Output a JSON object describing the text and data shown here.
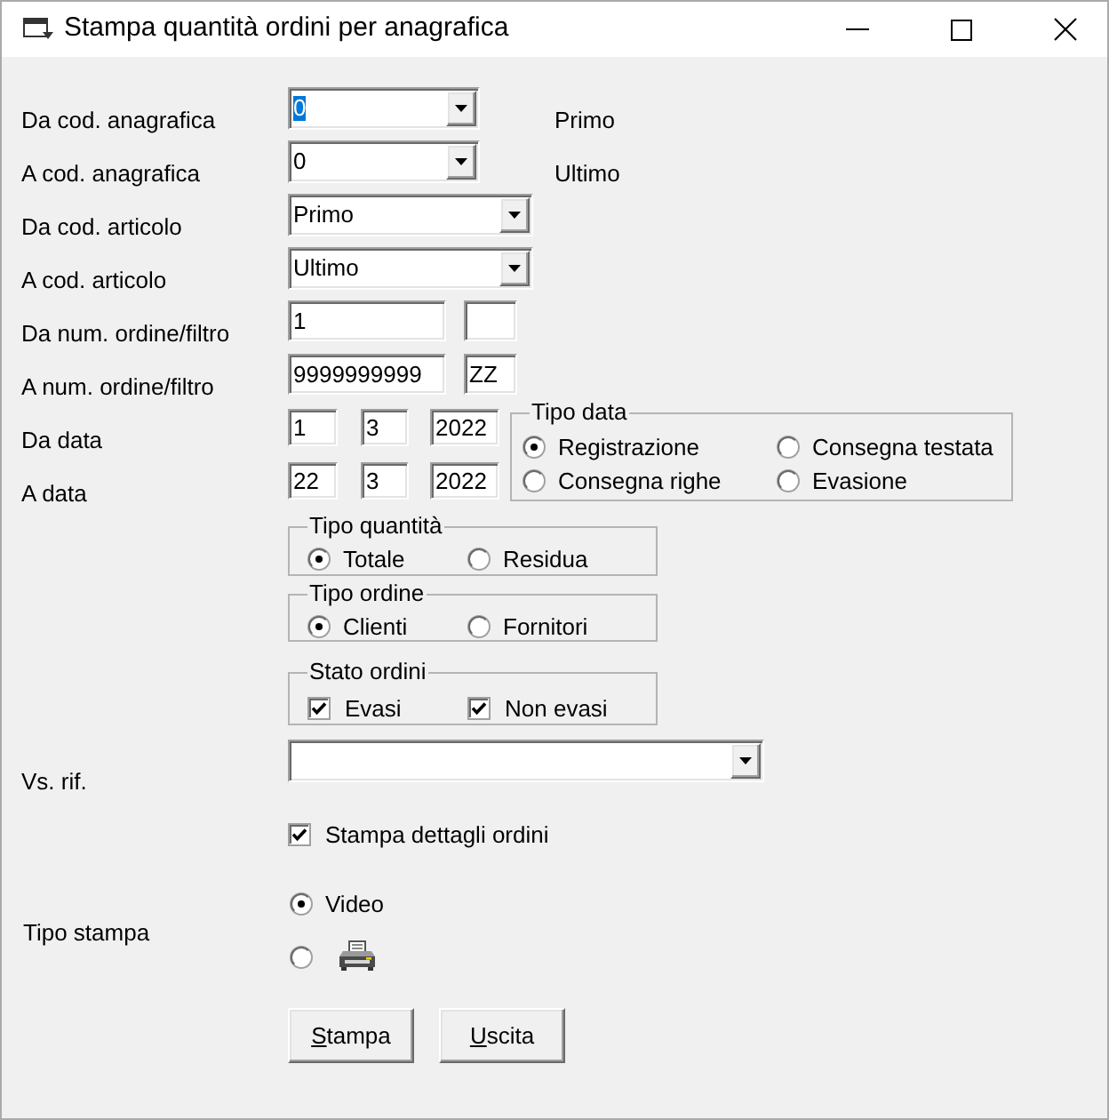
{
  "window": {
    "title": "Stampa quantità ordini per anagrafica"
  },
  "customer_range": [
    {
      "label": "Da cod. anagrafica",
      "value": "0",
      "highlighted": true,
      "note": "Primo"
    },
    {
      "label": "A cod. anagrafica",
      "value": "0",
      "highlighted": false,
      "note": "Ultimo"
    }
  ],
  "article_range": [
    {
      "label": "Da cod. articolo",
      "value": "Primo"
    },
    {
      "label": "A cod. articolo",
      "value": "Ultimo"
    }
  ],
  "order_range": [
    {
      "label": "Da num. ordine/filtro",
      "number": "1"
    },
    {
      "label": "A num. ordine/filtro",
      "number": "9999999999",
      "filter": "ZZ"
    }
  ],
  "dates": [
    {
      "label": "Da data",
      "day": "1",
      "month": "3",
      "year": "2022"
    },
    {
      "label": "A data",
      "day": "22",
      "month": "3",
      "year": "2022"
    }
  ],
  "date_type": {
    "title": "Tipo data",
    "options": [
      {
        "label": "Registrazione",
        "selected": true
      },
      {
        "label": "Consegna testata",
        "selected": false
      },
      {
        "label": "Consegna righe",
        "selected": false
      },
      {
        "label": "Evasione",
        "selected": false
      }
    ]
  },
  "quantity_type": {
    "title": "Tipo quantità",
    "options": [
      {
        "label": "Totale",
        "selected": true
      },
      {
        "label": "Residua",
        "selected": false
      }
    ]
  },
  "order_type": {
    "title": "Tipo ordine",
    "options": [
      {
        "label": "Clienti",
        "selected": true
      },
      {
        "label": "Fornitori",
        "selected": false
      }
    ]
  },
  "order_status": {
    "title": "Stato ordini",
    "options": [
      {
        "label": "Evasi",
        "checked": true
      },
      {
        "label": "Non evasi",
        "checked": true
      }
    ]
  },
  "reference": {
    "label": "Vs. rif."
  },
  "print_details": {
    "label": "Stampa dettagli ordini",
    "checked": true
  },
  "print_type": {
    "label": "Tipo stampa",
    "options": [
      {
        "kind": "text",
        "label": "Video",
        "selected": true
      },
      {
        "kind": "printer",
        "selected": false
      }
    ]
  },
  "buttons": [
    {
      "label": "Stampa"
    },
    {
      "label": "Uscita"
    }
  ]
}
